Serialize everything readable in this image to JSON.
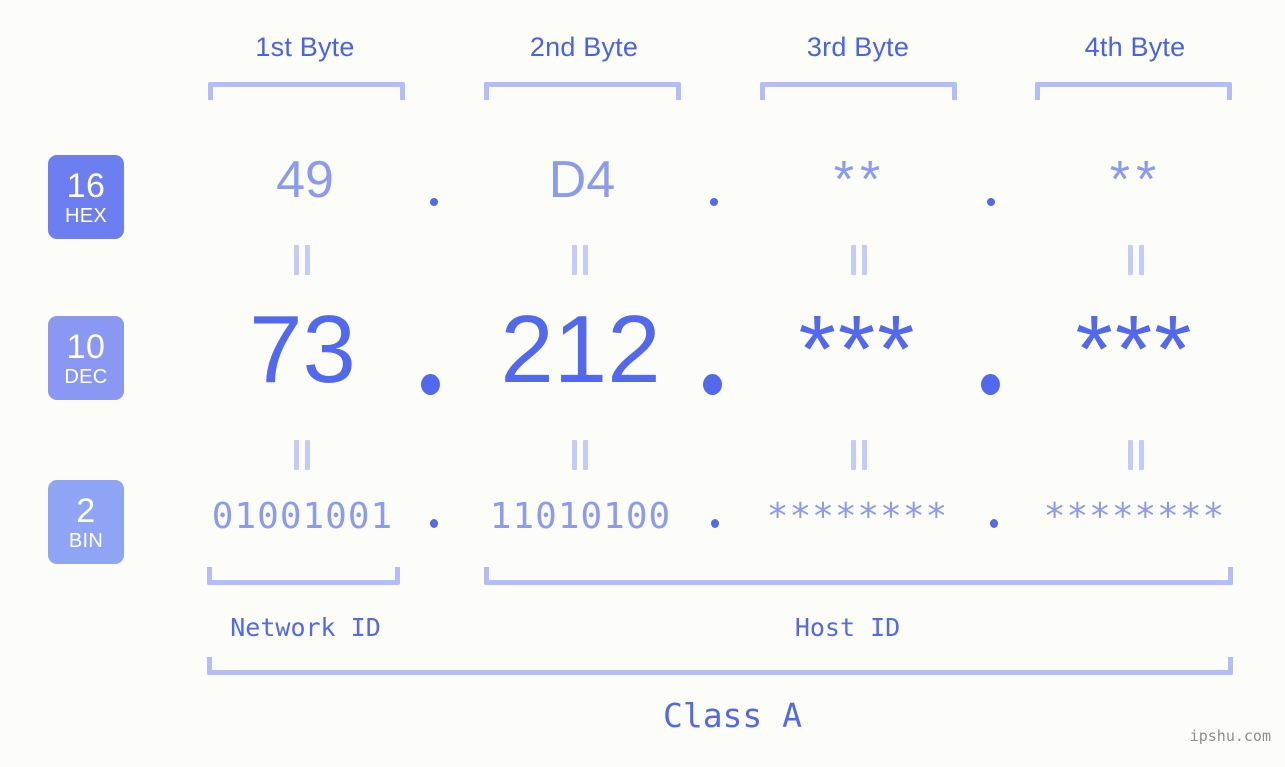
{
  "meta": {
    "background_color": "#fcfdf8",
    "accent_color": "#5168ef",
    "light_accent_color": "#8b9bf2",
    "bracket_color": "#b3bdfb",
    "watermark": "ipshu.com"
  },
  "byte_headers": [
    {
      "label": "1st Byte"
    },
    {
      "label": "2nd Byte"
    },
    {
      "label": "3rd Byte"
    },
    {
      "label": "4th Byte"
    }
  ],
  "bases": [
    {
      "number": "16",
      "abbr": "HEX",
      "color": "#6d7ef0"
    },
    {
      "number": "10",
      "abbr": "DEC",
      "color": "#8a97f3"
    },
    {
      "number": "2",
      "abbr": "BIN",
      "color": "#8fa4f5"
    }
  ],
  "rows": {
    "hex": {
      "base_number": "16",
      "base_abbr": "HEX",
      "values": [
        "49",
        "D4",
        "**",
        "**"
      ],
      "separator": "."
    },
    "dec": {
      "base_number": "10",
      "base_abbr": "DEC",
      "values": [
        "73",
        "212",
        "***",
        "***"
      ],
      "separator": "."
    },
    "bin": {
      "base_number": "2",
      "base_abbr": "BIN",
      "values": [
        "01001001",
        "11010100",
        "********",
        "********"
      ],
      "separator": "."
    }
  },
  "equals_marks": {
    "glyph": "=",
    "count_per_gap": 4
  },
  "regions": {
    "network_id": "Network ID",
    "host_id": "Host ID",
    "class": "Class A"
  }
}
